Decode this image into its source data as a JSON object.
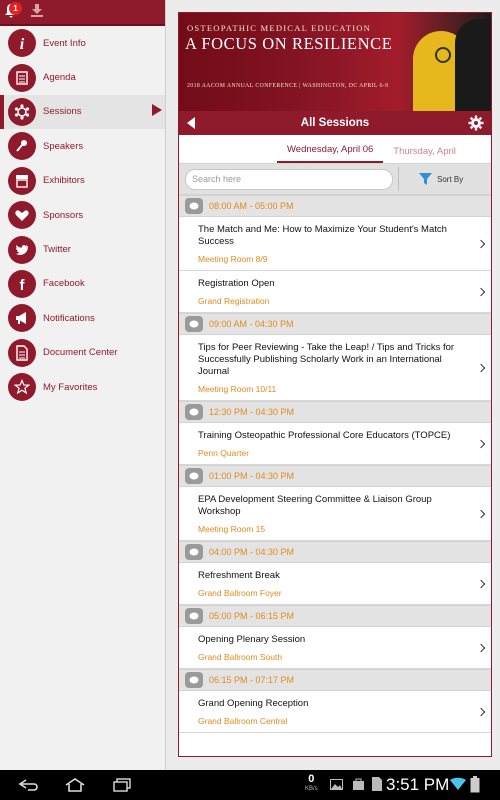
{
  "sidebar": {
    "notification_count": "1",
    "items": [
      {
        "label": "Event Info",
        "icon": "info-icon"
      },
      {
        "label": "Agenda",
        "icon": "agenda-icon"
      },
      {
        "label": "Sessions",
        "icon": "sessions-icon"
      },
      {
        "label": "Speakers",
        "icon": "microphone-icon"
      },
      {
        "label": "Exhibitors",
        "icon": "booth-icon"
      },
      {
        "label": "Sponsors",
        "icon": "handshake-icon"
      },
      {
        "label": "Twitter",
        "icon": "twitter-icon"
      },
      {
        "label": "Facebook",
        "icon": "facebook-icon"
      },
      {
        "label": "Notifications",
        "icon": "megaphone-icon"
      },
      {
        "label": "Document Center",
        "icon": "document-icon"
      },
      {
        "label": "My Favorites",
        "icon": "star-icon"
      }
    ]
  },
  "banner": {
    "line1": "OSTEOPATHIC MEDICAL EDUCATION",
    "line2": "A FOCUS ON RESILIENCE",
    "line3": "2018 AACOM ANNUAL CONFERENCE | WASHINGTON, DC APRIL 6-9"
  },
  "header": {
    "title": "All Sessions"
  },
  "tabs": {
    "active": "Wednesday, April 06",
    "next": "Thursday, April"
  },
  "search": {
    "placeholder": "Search here",
    "sort_label": "Sort By"
  },
  "groups": [
    {
      "time": "08:00 AM - 05:00 PM",
      "sessions": [
        {
          "title": "The Match and Me: How to Maximize Your Student's Match Success",
          "room": "Meeting Room 8/9"
        },
        {
          "title": "Registration Open",
          "room": "Grand Registration"
        }
      ]
    },
    {
      "time": "09:00 AM - 04:30 PM",
      "sessions": [
        {
          "title": "Tips for Peer Reviewing - Take the Leap! / Tips and Tricks for Successfully Publishing Scholarly Work in an International Journal",
          "room": "Meeting Room 10/11"
        }
      ]
    },
    {
      "time": "12:30 PM - 04:30 PM",
      "sessions": [
        {
          "title": "Training Osteopathic Professional Core Educators (TOPCE)",
          "room": "Penn Quarter"
        }
      ]
    },
    {
      "time": "01:00 PM - 04:30 PM",
      "sessions": [
        {
          "title": "EPA Development Steering Committee & Liaison Group Workshop",
          "room": "Meeting Room 15"
        }
      ]
    },
    {
      "time": "04:00 PM - 04:30 PM",
      "sessions": [
        {
          "title": "Refreshment Break",
          "room": "Grand Ballroom Foyer"
        }
      ]
    },
    {
      "time": "05:00 PM - 06:15 PM",
      "sessions": [
        {
          "title": "Opening Plenary Session",
          "room": "Grand Ballroom South"
        }
      ]
    },
    {
      "time": "06:15 PM - 07:17 PM",
      "sessions": [
        {
          "title": "Grand Opening Reception",
          "room": "Grand Ballroom Central"
        }
      ]
    }
  ],
  "statusbar": {
    "kb_value": "0",
    "kb_unit": "KB/s",
    "clock": "3:51 PM"
  },
  "colors": {
    "brand": "#8f1a2c",
    "accent": "#e18a1e"
  }
}
